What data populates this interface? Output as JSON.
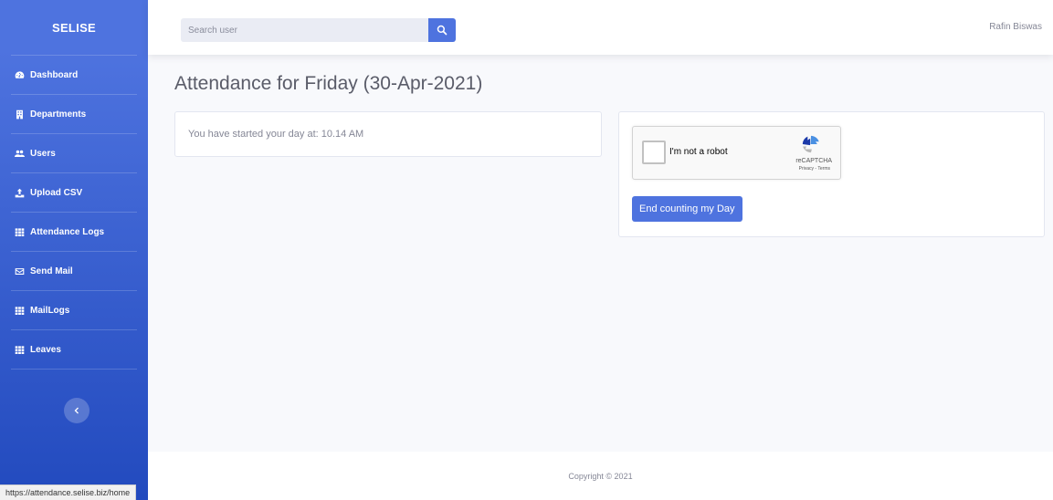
{
  "sidebar": {
    "brand": "SELISE",
    "items": [
      {
        "label": "Dashboard",
        "icon": "tachometer-icon"
      },
      {
        "label": "Departments",
        "icon": "building-icon"
      },
      {
        "label": "Users",
        "icon": "users-icon"
      },
      {
        "label": "Upload CSV",
        "icon": "upload-icon"
      },
      {
        "label": "Attendance Logs",
        "icon": "table-icon"
      },
      {
        "label": "Send Mail",
        "icon": "envelope-icon"
      },
      {
        "label": "MailLogs",
        "icon": "table-icon"
      },
      {
        "label": "Leaves",
        "icon": "table-icon"
      }
    ],
    "toggle_icon": "chevron-left-icon"
  },
  "topbar": {
    "search_placeholder": "Search user",
    "search_icon": "search-icon",
    "user_name": "Rafin Biswas"
  },
  "main": {
    "title": "Attendance for Friday (30-Apr-2021)",
    "start_message": "You have started your day at: 10.14 AM",
    "captcha": {
      "label": "I'm not a robot",
      "brand": "reCAPTCHA",
      "links": "Privacy - Terms"
    },
    "end_button": "End counting my Day"
  },
  "footer": {
    "copyright": "Copyright © 2021"
  },
  "status_bar": {
    "url": "https://attendance.selise.biz/home"
  },
  "colors": {
    "primary": "#4e73df",
    "sidebar_gradient_end": "#224abe",
    "background": "#f8f9fc"
  }
}
